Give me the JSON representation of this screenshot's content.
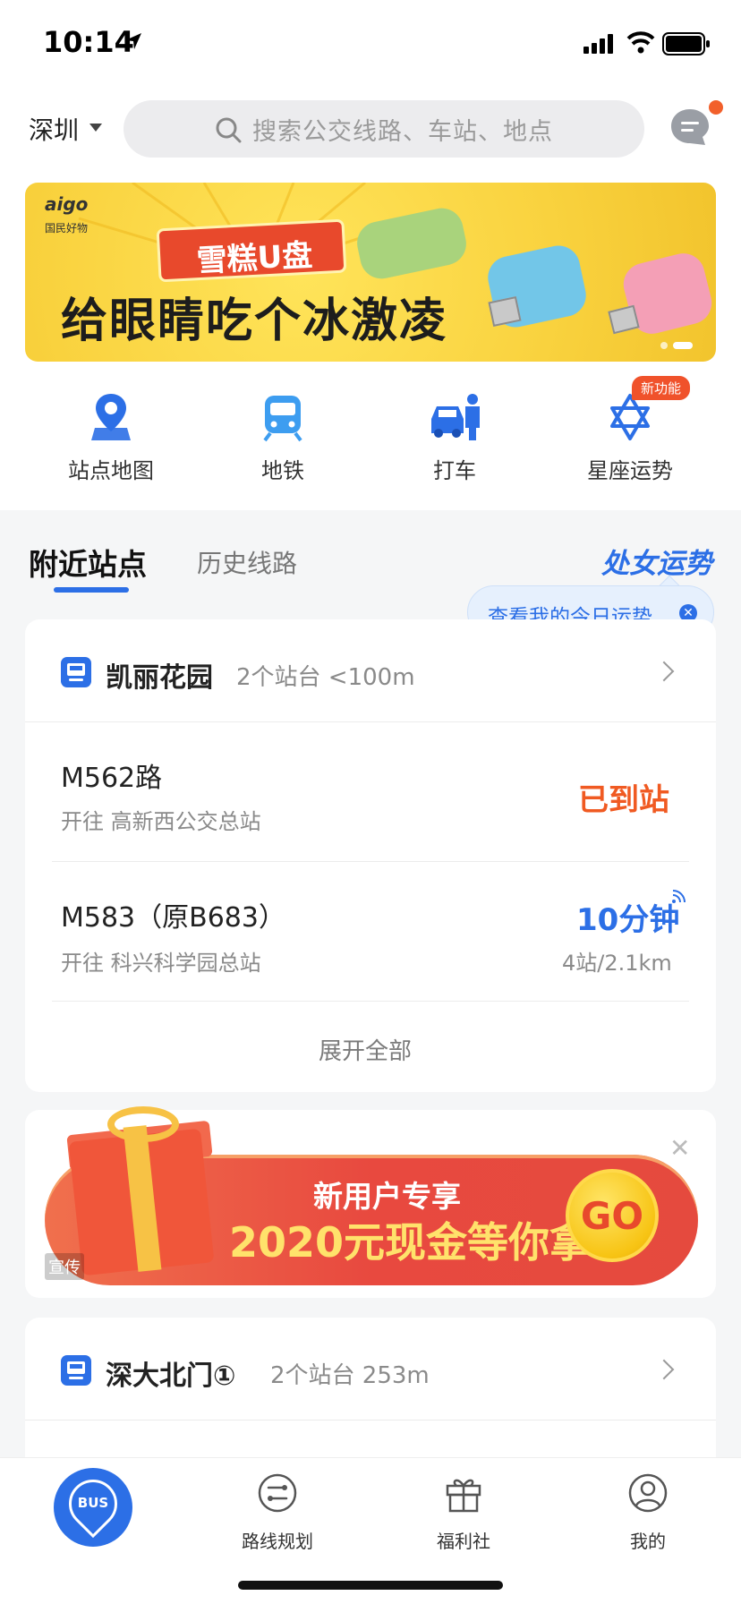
{
  "status_bar": {
    "time": "10:14"
  },
  "header": {
    "city": "深圳",
    "search_placeholder": "搜索公交线路、车站、地点"
  },
  "banner": {
    "brand": "aigo",
    "brand_sub": "国民好物",
    "badge": "雪糕U盘",
    "headline": "给眼睛吃个冰激凌"
  },
  "quick_entries": [
    {
      "label": "站点地图",
      "icon": "map-pin-icon"
    },
    {
      "label": "地铁",
      "icon": "subway-icon"
    },
    {
      "label": "打车",
      "icon": "taxi-icon"
    },
    {
      "label": "星座运势",
      "icon": "star-of-david-icon",
      "tag": "新功能"
    }
  ],
  "tabs": {
    "active": "附近站点",
    "second": "历史线路",
    "horoscope": "处女运势"
  },
  "tooltip": "查看我的今日运势",
  "station1": {
    "name": "凯丽花园",
    "meta": "2个站台 <100m",
    "routes": [
      {
        "name": "M562路",
        "dest": "开往 高新西公交总站",
        "status": "已到站"
      },
      {
        "name": "M583（原B683）",
        "dest": "开往 科兴科学园总站",
        "eta": "10分钟",
        "eta_sub": "4站/2.1km"
      }
    ],
    "expand": "展开全部"
  },
  "promo": {
    "line1": "新用户专享",
    "line2": "2020元现金等你拿",
    "go": "GO",
    "ad_tag": "宣传"
  },
  "station2": {
    "name": "深大北门①",
    "meta": "2个站台 253m"
  },
  "tabbar": {
    "home": "BUS",
    "items": [
      {
        "label": "路线规划"
      },
      {
        "label": "福利社"
      },
      {
        "label": "我的"
      }
    ]
  },
  "colors": {
    "accent": "#2c6fe6",
    "orange": "#f05a22"
  }
}
